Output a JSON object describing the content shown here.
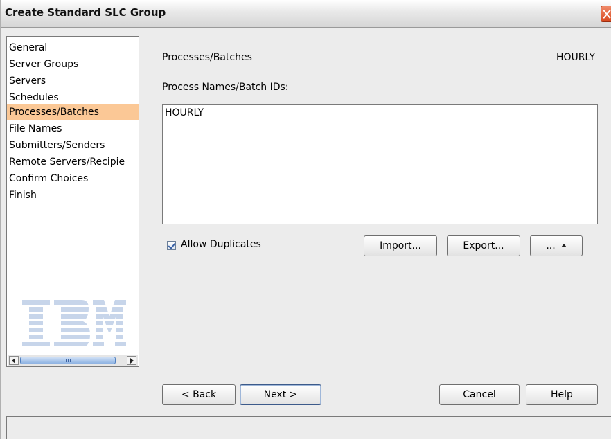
{
  "window": {
    "title": "Create Standard SLC Group"
  },
  "nav": {
    "items": [
      {
        "label": "General",
        "selected": false
      },
      {
        "label": "Server Groups",
        "selected": false
      },
      {
        "label": "Servers",
        "selected": false
      },
      {
        "label": "Schedules",
        "selected": false
      },
      {
        "label": "Processes/Batches",
        "selected": true
      },
      {
        "label": "File Names",
        "selected": false
      },
      {
        "label": "Submitters/Senders",
        "selected": false
      },
      {
        "label": "Remote Servers/Recipie",
        "selected": false
      },
      {
        "label": "Confirm Choices",
        "selected": false
      },
      {
        "label": "Finish",
        "selected": false
      }
    ],
    "logo": "IBM",
    "selected_color": "#fbc896"
  },
  "main": {
    "section_title": "Processes/Batches",
    "section_value": "HOURLY",
    "field_label": "Process Names/Batch IDs:",
    "textarea_value": "HOURLY",
    "allow_duplicates_label": "Allow Duplicates",
    "allow_duplicates_checked": true,
    "import_label": "Import...",
    "export_label": "Export...",
    "more_label": "...",
    "more_icon": "caret-up-icon"
  },
  "footer": {
    "back_label": "< Back",
    "next_label": "Next >",
    "cancel_label": "Cancel",
    "help_label": "Help"
  },
  "icons": {
    "close": "close-icon",
    "checkbox": "checkmark-icon",
    "scroll_left": "arrow-left-icon",
    "scroll_right": "arrow-right-icon"
  }
}
